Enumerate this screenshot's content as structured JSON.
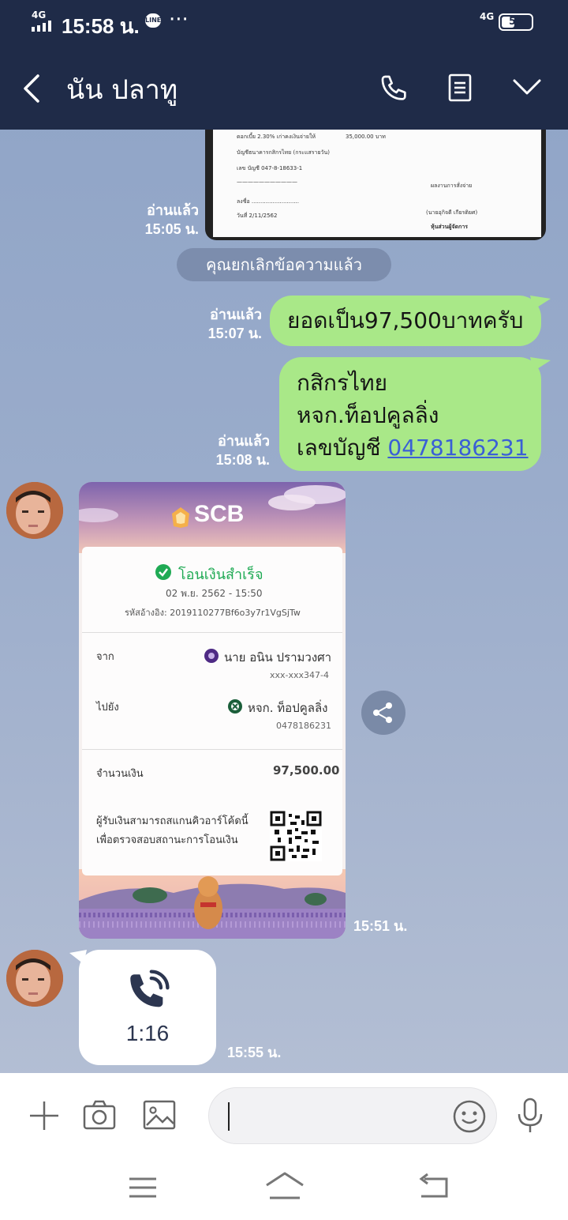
{
  "status_bar": {
    "network": "4G",
    "time": "15:58 น.",
    "app_badge": "LINE",
    "more": "···",
    "data_type": "4G",
    "battery": "50"
  },
  "header": {
    "title": "นัน ปลาทู",
    "icons": [
      "back-icon",
      "phone-icon",
      "notes-icon",
      "chevron-down-icon"
    ]
  },
  "messages": {
    "doc_read": "อ่านแล้ว",
    "doc_time": "15:05 น.",
    "system_notice": "คุณยกเลิกข้อความแล้ว",
    "m1": {
      "read": "อ่านแล้ว",
      "time": "15:07 น.",
      "text": "ยอดเป็น97,500บาทครับ"
    },
    "m2": {
      "read": "อ่านแล้ว",
      "time": "15:08 น.",
      "line1": "กสิกรไทย",
      "line2": "หจก.ท็อปคูลลิ่ง",
      "line3_prefix": "เลขบัญชี ",
      "account_link": "0478186231"
    },
    "receipt_time": "15:51 น.",
    "call": {
      "duration": "1:16",
      "time": "15:55 น."
    }
  },
  "receipt": {
    "bank": "SCB",
    "status": "โอนเงินสำเร็จ",
    "datetime": "02 พ.ย. 2562 - 15:50",
    "reference": "รหัสอ้างอิง: 2019110277Bf6o3y7r1VgSjTw",
    "from_label": "จาก",
    "from_name": "นาย อนิน ปรามวงศา",
    "from_account": "xxx-xxx347-4",
    "to_label": "ไปยัง",
    "to_name": "หจก. ท็อปคูลลิ่ง",
    "to_account": "0478186231",
    "amount_label": "จำนวนเงิน",
    "amount": "97,500.00",
    "note_line1": "ผู้รับเงินสามารถสแกนคิวอาร์โค้ดนี้",
    "note_line2": "เพื่อตรวจสอบสถานะการโอนเงิน"
  },
  "document_preview": {
    "line_a": "ดอกเบี้ย 2.30% เก่าคงเงินจ่ายให้",
    "line_b": "35,000.00 บาท",
    "line_c": "บัญชีธนาคารกสิกรไทย (กระแสรายวัน)",
    "line_d": "เลข บัญชี 047-8-18633-1",
    "signature": "ลงชื่อ ...........................",
    "date": "วันที่ 2/11/2562",
    "signer": "(นายอุกิจดี เกียรติยศ)",
    "signer_role": "หุ้นส่วนผู้จัดการ",
    "approver": "ผลงานการสั่งจ่าย"
  },
  "input_bar": {
    "icons": [
      "plus-icon",
      "camera-icon",
      "image-icon",
      "emoji-icon",
      "mic-icon"
    ],
    "placeholder": ""
  },
  "nav_bar": {
    "icons": [
      "menu-icon",
      "home-icon",
      "back-nav-icon"
    ]
  }
}
